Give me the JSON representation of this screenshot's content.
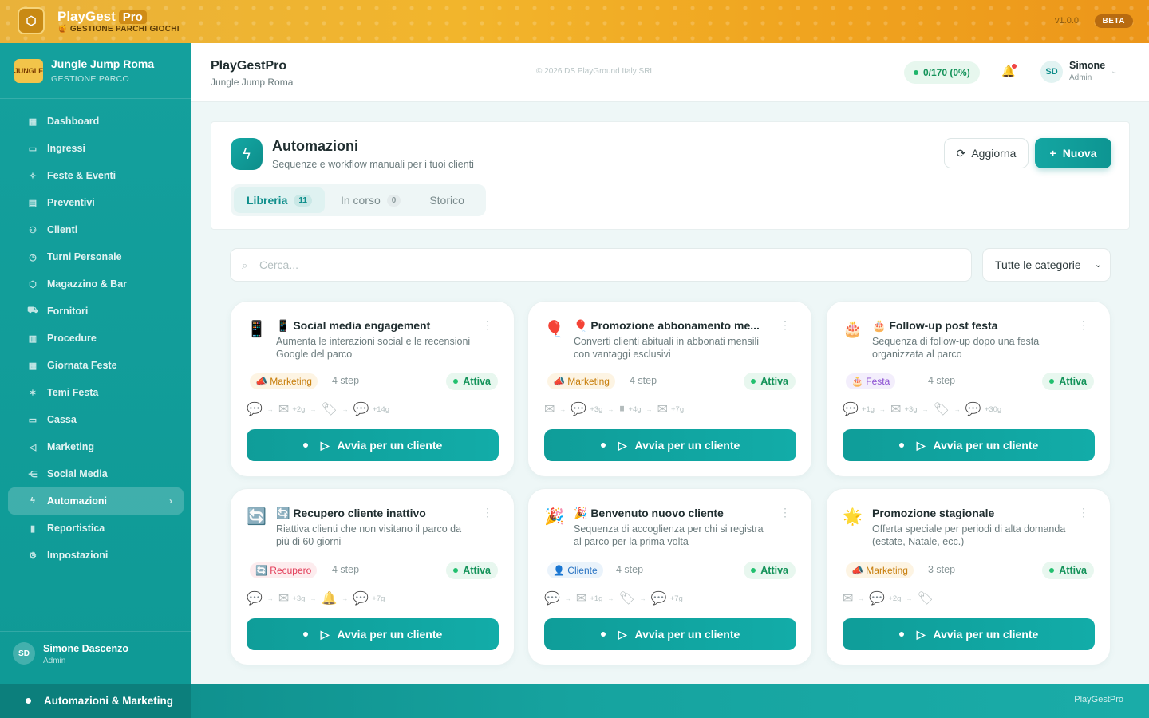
{
  "topbar": {
    "brand": "PlayGest",
    "brand_pro": "Pro",
    "subtitle": "🍯 GESTIONE PARCHI GIOCHI",
    "version": "v1.0.0",
    "beta": "BETA"
  },
  "sidebar": {
    "park_logo": "JUNGLE",
    "park_name": "Jungle Jump Roma",
    "park_sub": "GESTIONE PARCO",
    "items": [
      {
        "label": "Dashboard",
        "icon": "dashboard-icon",
        "glyph": "▦"
      },
      {
        "label": "Ingressi",
        "icon": "ticket-icon",
        "glyph": "▭"
      },
      {
        "label": "Feste & Eventi",
        "icon": "party-icon",
        "glyph": "✧"
      },
      {
        "label": "Preventivi",
        "icon": "document-icon",
        "glyph": "▤"
      },
      {
        "label": "Clienti",
        "icon": "users-icon",
        "glyph": "⚇"
      },
      {
        "label": "Turni Personale",
        "icon": "clock-icon",
        "glyph": "◷"
      },
      {
        "label": "Magazzino & Bar",
        "icon": "box-icon",
        "glyph": "⬡"
      },
      {
        "label": "Fornitori",
        "icon": "truck-icon",
        "glyph": "⛟"
      },
      {
        "label": "Procedure",
        "icon": "clipboard-icon",
        "glyph": "▥"
      },
      {
        "label": "Giornata Feste",
        "icon": "calendar-icon",
        "glyph": "▦"
      },
      {
        "label": "Temi Festa",
        "icon": "wand-icon",
        "glyph": "✶"
      },
      {
        "label": "Cassa",
        "icon": "card-icon",
        "glyph": "▭"
      },
      {
        "label": "Marketing",
        "icon": "megaphone-icon",
        "glyph": "◁"
      },
      {
        "label": "Social Media",
        "icon": "share-icon",
        "glyph": "⋲"
      },
      {
        "label": "Automazioni",
        "icon": "lightning-icon",
        "glyph": "ϟ",
        "active": true
      },
      {
        "label": "Reportistica",
        "icon": "chart-icon",
        "glyph": "▮"
      },
      {
        "label": "Impostazioni",
        "icon": "gear-icon",
        "glyph": "⚙"
      }
    ],
    "user": {
      "initials": "SD",
      "name": "Simone Dascenzo",
      "role": "Admin"
    }
  },
  "header": {
    "title": "PlayGestPro",
    "subtitle": "Jungle Jump Roma",
    "copyright": "© 2026 DS PlayGround Italy SRL",
    "count": "0/170 (0%)",
    "user_initials": "SD",
    "user_name": "Simone",
    "user_role": "Admin"
  },
  "panel": {
    "title": "Automazioni",
    "subtitle": "Sequenze e workflow manuali per i tuoi clienti",
    "refresh": "Aggiorna",
    "new": "Nuova",
    "tabs": [
      {
        "label": "Libreria",
        "badge": "11"
      },
      {
        "label": "In corso",
        "badge": "0"
      },
      {
        "label": "Storico",
        "badge": ""
      }
    ]
  },
  "search": {
    "placeholder": "Cerca...",
    "category": "Tutte le categorie"
  },
  "cards": [
    {
      "emoji": "📱",
      "title": "📱 Social media engagement",
      "desc": "Aumenta le interazioni social e le recensioni Google del parco",
      "tag": "📣 Marketing",
      "tag_type": "marketing",
      "steps": "4 step",
      "status": "Attiva",
      "flow": [
        {
          "g": "💬"
        },
        {
          "g": "✉",
          "t": "+2g"
        },
        {
          "g": "🏷"
        },
        {
          "g": "💬",
          "t": "+14g"
        }
      ],
      "button": "Avvia per un cliente"
    },
    {
      "emoji": "🎈",
      "title": "🎈 Promozione abbonamento me...",
      "desc": "Converti clienti abituali in abbonati mensili con vantaggi esclusivi",
      "tag": "📣 Marketing",
      "tag_type": "marketing",
      "steps": "4 step",
      "status": "Attiva",
      "flow": [
        {
          "g": "✉"
        },
        {
          "g": "💬",
          "t": "+3g"
        },
        {
          "g": "⏸",
          "t": "+4g"
        },
        {
          "g": "✉",
          "t": "+7g"
        }
      ],
      "button": "Avvia per un cliente"
    },
    {
      "emoji": "🎂",
      "title": "🎂 Follow-up post festa",
      "desc": "Sequenza di follow-up dopo una festa organizzata al parco",
      "tag": "🎂 Festa",
      "tag_type": "festa",
      "steps": "4 step",
      "status": "Attiva",
      "flow": [
        {
          "g": "💬",
          "t": "+1g"
        },
        {
          "g": "✉",
          "t": "+3g"
        },
        {
          "g": "🏷"
        },
        {
          "g": "💬",
          "t": "+30g"
        }
      ],
      "button": "Avvia per un cliente"
    },
    {
      "emoji": "🔄",
      "title": "🔄 Recupero cliente inattivo",
      "desc": "Riattiva clienti che non visitano il parco da più di 60 giorni",
      "tag": "🔄 Recupero",
      "tag_type": "recupero",
      "steps": "4 step",
      "status": "Attiva",
      "flow": [
        {
          "g": "💬"
        },
        {
          "g": "✉",
          "t": "+3g"
        },
        {
          "g": "🔔"
        },
        {
          "g": "💬",
          "t": "+7g"
        }
      ],
      "button": "Avvia per un cliente"
    },
    {
      "emoji": "🎉",
      "title": "🎉 Benvenuto nuovo cliente",
      "desc": "Sequenza di accoglienza per chi si registra al parco per la prima volta",
      "tag": "👤 Cliente",
      "tag_type": "cliente",
      "steps": "4 step",
      "status": "Attiva",
      "flow": [
        {
          "g": "💬"
        },
        {
          "g": "✉",
          "t": "+1g"
        },
        {
          "g": "🏷"
        },
        {
          "g": "💬",
          "t": "+7g"
        }
      ],
      "button": "Avvia per un cliente"
    },
    {
      "emoji": "🌟",
      "title": "Promozione stagionale",
      "desc": "Offerta speciale per periodi di alta domanda (estate, Natale, ecc.)",
      "tag": "📣 Marketing",
      "tag_type": "marketing",
      "steps": "3 step",
      "status": "Attiva",
      "flow": [
        {
          "g": "✉"
        },
        {
          "g": "💬",
          "t": "+2g"
        },
        {
          "g": "🏷"
        }
      ],
      "button": "Avvia per un cliente"
    }
  ],
  "bottombar": {
    "left": "Automazioni & Marketing",
    "right": "PlayGestPro"
  }
}
